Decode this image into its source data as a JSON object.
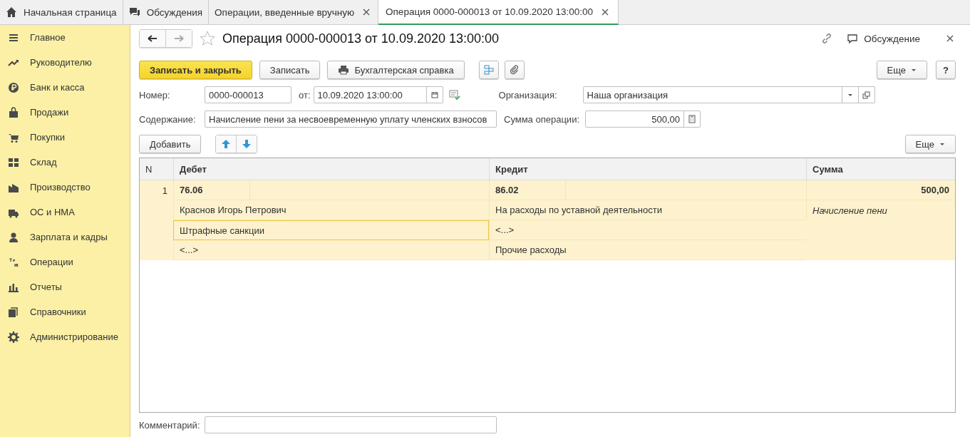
{
  "tabs": [
    {
      "label": "Начальная страница",
      "closable": false,
      "selected": false
    },
    {
      "label": "Обсуждения",
      "closable": false,
      "selected": false
    },
    {
      "label": "Операции, введенные вручную",
      "closable": true,
      "selected": false
    },
    {
      "label": "Операция 0000-000013 от 10.09.2020 13:00:00",
      "closable": true,
      "selected": true
    }
  ],
  "sidebar": {
    "items": [
      {
        "label": "Главное"
      },
      {
        "label": "Руководителю"
      },
      {
        "label": "Банк и касса"
      },
      {
        "label": "Продажи"
      },
      {
        "label": "Покупки"
      },
      {
        "label": "Склад"
      },
      {
        "label": "Производство"
      },
      {
        "label": "ОС и НМА"
      },
      {
        "label": "Зарплата и кадры"
      },
      {
        "label": "Операции"
      },
      {
        "label": "Отчеты"
      },
      {
        "label": "Справочники"
      },
      {
        "label": "Администрирование"
      }
    ]
  },
  "form": {
    "title": "Операция 0000-000013 от 10.09.2020 13:00:00",
    "discussion": "Обсуждение",
    "toolbar": {
      "buttons": [
        {
          "label": "Записать и закрыть",
          "kind": "primary"
        },
        {
          "label": "Записать",
          "kind": "plain"
        },
        {
          "label": "Бухгалтерская справка",
          "kind": "print"
        }
      ],
      "more": "Еще",
      "help": "?"
    },
    "number": {
      "label": "Номер:",
      "value": "0000-000013"
    },
    "date": {
      "label": "от:",
      "value": "10.09.2020 13:00:00"
    },
    "organization": {
      "label": "Организация:",
      "value": "Наша организация"
    },
    "content": {
      "label": "Содержание:",
      "value": "Начисление пени за несвоевременную уплату членских взносов"
    },
    "amount": {
      "label": "Сумма операции:",
      "value": "500,00"
    },
    "table_toolbar": {
      "add": "Добавить",
      "more": "Еще"
    },
    "table": {
      "columns": [
        "N",
        "Дебет",
        "Кредит",
        "Сумма"
      ],
      "rows": [
        {
          "n": "1",
          "selected": true,
          "debit": {
            "account": "76.06",
            "subconto": [
              {
                "text": "Краснов Игорь Петрович",
                "selected": false
              },
              {
                "text": "Штрафные санкции",
                "selected": true
              },
              {
                "text": "<...>",
                "selected": false
              }
            ]
          },
          "credit": {
            "account": "86.02",
            "subconto": [
              {
                "text": "На расходы по уставной деятельности",
                "selected": false
              },
              {
                "text": "<...>",
                "selected": false
              },
              {
                "text": "Прочие расходы",
                "selected": false
              }
            ]
          },
          "sum": "500,00",
          "description": "Начисление пени"
        }
      ]
    },
    "comment": {
      "label": "Комментарий:"
    }
  }
}
